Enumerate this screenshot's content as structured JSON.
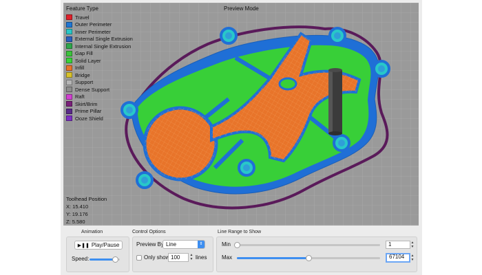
{
  "viewport": {
    "mode_label": "Preview Mode",
    "background_color": "#9a9a9a"
  },
  "legend": {
    "title": "Feature Type",
    "items": [
      {
        "label": "Travel",
        "color": "#e0202a"
      },
      {
        "label": "Outer Perimeter",
        "color": "#1f77d4"
      },
      {
        "label": "Inner Perimeter",
        "color": "#28c8c8"
      },
      {
        "label": "External Single Extrusion",
        "color": "#2a5fbf"
      },
      {
        "label": "Internal Single Extrusion",
        "color": "#2ea84a"
      },
      {
        "label": "Gap Fill",
        "color": "#3cc43c"
      },
      {
        "label": "Solid Layer",
        "color": "#37d437"
      },
      {
        "label": "Infill",
        "color": "#e8742a"
      },
      {
        "label": "Bridge",
        "color": "#d8c22a"
      },
      {
        "label": "Support",
        "color": "#b5b5b5"
      },
      {
        "label": "Dense Support",
        "color": "#8c8c8c"
      },
      {
        "label": "Raft",
        "color": "#d23fd2"
      },
      {
        "label": "Skirt/Brim",
        "color": "#7a1f7a"
      },
      {
        "label": "Prime Pillar",
        "color": "#5a2a8a"
      },
      {
        "label": "Ooze Shield",
        "color": "#7d2fc4"
      }
    ]
  },
  "toolhead": {
    "title": "Toolhead Position",
    "x": "X: 15.410",
    "y": "Y: 19.176",
    "z": "Z: 5.580"
  },
  "animation": {
    "group_label": "Animation",
    "play_label": "Play/Pause",
    "play_icon": "play-pause-icon",
    "speed_label": "Speed:",
    "speed_fraction": 0.85
  },
  "control_options": {
    "group_label": "Control Options",
    "preview_by_label": "Preview By",
    "preview_by_value": "Line",
    "only_show_label": "Only show",
    "only_show_value": "100",
    "lines_label": "lines",
    "only_show_checked": false
  },
  "line_range": {
    "group_label": "Line Range to Show",
    "min_label": "Min",
    "min_value": "1",
    "max_label": "Max",
    "max_value": "67104",
    "min_fraction": 0.0,
    "max_fraction": 0.5
  },
  "colors": {
    "accent": "#3d8ef0",
    "panel": "#ececec"
  }
}
